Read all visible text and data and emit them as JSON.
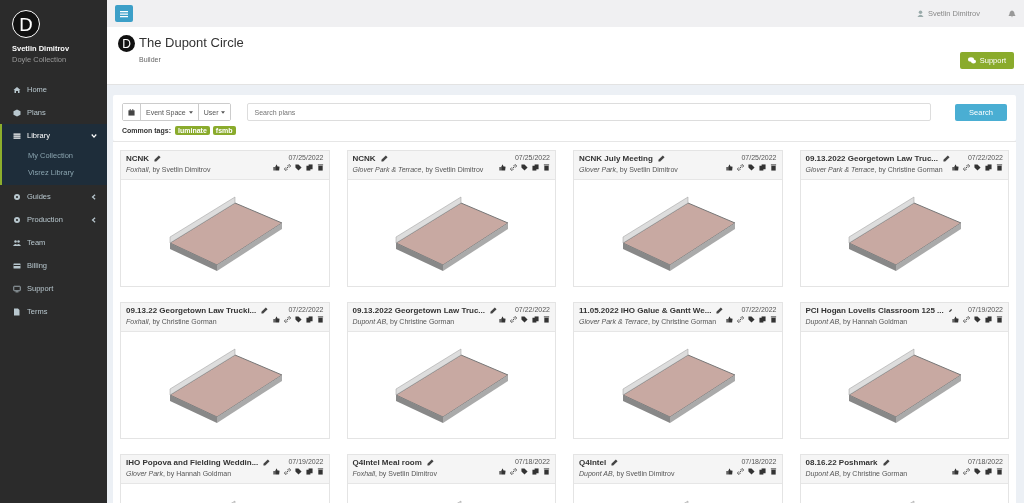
{
  "sidebar": {
    "user_name": "Svetlin Dimitrov",
    "collection": "Doyle Collection",
    "logo_letter": "D",
    "items": [
      {
        "label": "Home",
        "kind": "link",
        "selected": false
      },
      {
        "label": "Plans",
        "kind": "link",
        "selected": false
      },
      {
        "label": "Library",
        "kind": "group",
        "selected": true,
        "expanded": true,
        "children": [
          {
            "label": "My Collection"
          },
          {
            "label": "Visrez Library"
          }
        ]
      },
      {
        "label": "Guides",
        "kind": "group",
        "selected": false,
        "expanded": false
      },
      {
        "label": "Production",
        "kind": "group",
        "selected": false,
        "expanded": false
      },
      {
        "label": "Team",
        "kind": "link",
        "selected": false
      },
      {
        "label": "Billing",
        "kind": "link",
        "selected": false
      },
      {
        "label": "Support",
        "kind": "link",
        "selected": false
      },
      {
        "label": "Terms",
        "kind": "link",
        "selected": false
      }
    ]
  },
  "topbar": {
    "user": "Svetlin Dimitrov"
  },
  "header": {
    "logo_letter": "D",
    "title": "The Dupont Circle",
    "subtitle": "Builder",
    "support_button": "Support"
  },
  "filters": {
    "dropdowns": [
      "Event Space",
      "User"
    ],
    "search": {
      "placeholder": "Search plans"
    },
    "search_button": "Search",
    "tags_label": "Common tags:",
    "tags": [
      "luminate",
      "fsmb"
    ]
  },
  "plans": [
    {
      "title": "NCNK",
      "subtitle": "*Foxhall*, by Svetlin Dimitrov",
      "date": "07/25/2022"
    },
    {
      "title": "NCNK",
      "subtitle": "*Glover Park & Terrace*, by Svetlin Dimitrov",
      "date": "07/25/2022"
    },
    {
      "title": "NCNK July Meeting",
      "subtitle": "*Glover Park*, by Svetlin Dimitrov",
      "date": "07/25/2022"
    },
    {
      "title": "09.13.2022 Georgetown Law Truc...",
      "subtitle": "*Glover Park & Terrace*, by Christine Gorman",
      "date": "07/22/2022"
    },
    {
      "title": "09.13.22 Georgetown Law Trucki...",
      "subtitle": "*Foxhall*, by Christine Gorman",
      "date": "07/22/2022"
    },
    {
      "title": "09.13.2022 Georgetown Law Truc...",
      "subtitle": "*Dupont AB*, by Christine Gorman",
      "date": "07/22/2022"
    },
    {
      "title": "11.05.2022 IHO Galue & Gantt We...",
      "subtitle": "*Glover Park & Terrace*, by Christine Gorman",
      "date": "07/22/2022"
    },
    {
      "title": "PCI Hogan Lovells Classroom 125 ...",
      "subtitle": "*Dupont AB*, by Hannah Goldman",
      "date": "07/19/2022"
    },
    {
      "title": "IHO Popova and Fielding Weddin...",
      "subtitle": "*Glover Park*, by Hannah Goldman",
      "date": "07/19/2022"
    },
    {
      "title": "Q4Intel Meal room",
      "subtitle": "*Foxhall*, by Svetlin Dimitrov",
      "date": "07/18/2022"
    },
    {
      "title": "Q4Intel",
      "subtitle": "*Dupont AB*, by Svetlin Dimitrov",
      "date": "07/18/2022"
    },
    {
      "title": "08.16.22 Poshmark",
      "subtitle": "*Dupont AB*, by Christine Gorman",
      "date": "07/18/2022"
    }
  ]
}
